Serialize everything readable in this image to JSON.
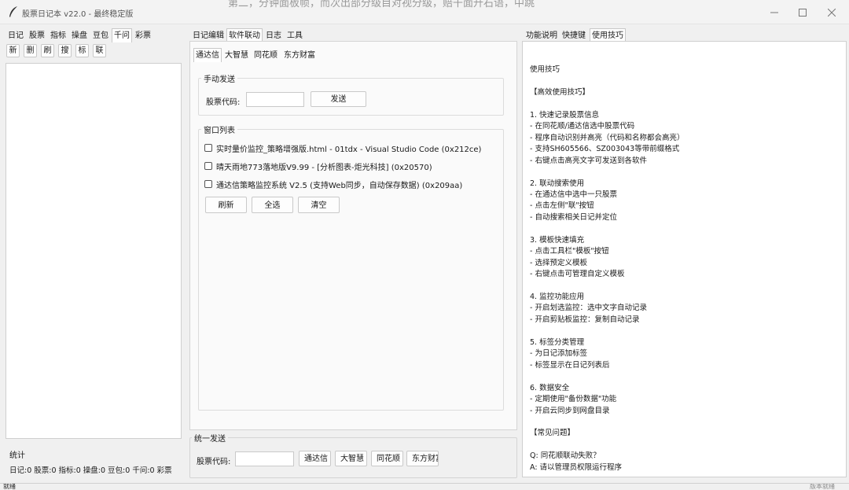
{
  "window": {
    "title": "股票日记本 v22.0 - 最终稳定版",
    "background_text": "第二，分钟面板帧，而次出部分级目对视分级，赔干面升石语，中跳"
  },
  "left": {
    "tabs": [
      "日记",
      "股票",
      "指标",
      "操盘",
      "豆包",
      "千问",
      "彩票"
    ],
    "active_tab": "千问",
    "toolbar": [
      "新",
      "删",
      "刷",
      "搜",
      "标",
      "联"
    ],
    "stats_title": "统计",
    "stats_text": "日记:0 股票:0 指标:0 操盘:0 豆包:0 千问:0 彩票"
  },
  "middle": {
    "tabs": [
      "日记编辑",
      "软件联动",
      "日志",
      "工具"
    ],
    "active_tab": "软件联动",
    "subtabs": [
      "通达信",
      "大智慧",
      "同花顺",
      "东方财富"
    ],
    "active_subtab": "通达信",
    "manual_send": {
      "title": "手动发送",
      "code_label": "股票代码:",
      "code_value": "",
      "send_button": "发送"
    },
    "window_list": {
      "title": "窗口列表",
      "items": [
        "实时量价监控_策略增强版.html - 01tdx - Visual Studio Code (0x212ce)",
        "晴天雨地773落地版V9.99 - [分析图表-炬光科技] (0x20570)",
        "通达信策略监控系统 V2.5 (支持Web同步，自动保存数据) (0x209aa)"
      ],
      "buttons": [
        "刷新",
        "全选",
        "清空"
      ]
    },
    "unified_send": {
      "title": "统一发送",
      "code_label": "股票代码:",
      "code_value": "",
      "buttons": [
        "通达信",
        "大智慧",
        "同花顺",
        "东方财富"
      ]
    }
  },
  "right": {
    "tabs": [
      "功能说明",
      "快捷键",
      "使用技巧"
    ],
    "active_tab": "使用技巧",
    "lines": [
      "使用技巧",
      "",
      "【高效使用技巧】",
      "",
      "1. 快速记录股票信息",
      "   - 在同花顺/通达信选中股票代码",
      "   - 程序自动识别并高亮（代码和名称都会高亮）",
      "   - 支持SH605566、SZ003043等带前缀格式",
      "   - 右键点击高亮文字可发送到各软件",
      "",
      "2. 联动搜索使用",
      "   - 在通达信中选中一只股票",
      "   - 点击左侧\"联\"按钮",
      "   - 自动搜索相关日记并定位",
      "",
      "3. 模板快速填充",
      "   - 点击工具栏\"模板\"按钮",
      "   - 选择预定义模板",
      "   - 右键点击可管理自定义模板",
      "",
      "4. 监控功能应用",
      "   - 开启划选监控：选中文字自动记录",
      "   - 开启剪贴板监控：复制自动记录",
      "",
      "5. 标签分类管理",
      "   - 为日记添加标签",
      "   - 标签显示在日记列表后",
      "",
      "6. 数据安全",
      "   - 定期使用\"备份数据\"功能",
      "   - 开启云同步到网盘目录",
      "",
      "【常见问题】",
      "",
      "Q: 同花顺联动失败？",
      "A: 请以管理员权限运行程序"
    ]
  },
  "status": {
    "left": "就绪",
    "right": "版本就绪"
  }
}
